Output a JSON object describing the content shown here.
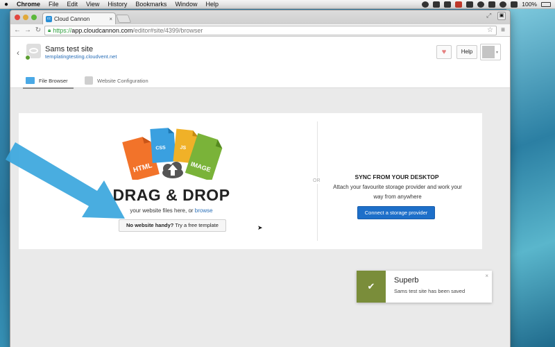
{
  "menubar": {
    "app": "Chrome",
    "items": [
      "File",
      "Edit",
      "View",
      "History",
      "Bookmarks",
      "Window",
      "Help"
    ],
    "battery": "100%"
  },
  "browser": {
    "tab_title": "Cloud Cannon",
    "tab_close": "×",
    "url": {
      "scheme": "https://",
      "host": "app.cloudcannon.com",
      "path": "/editor#site/4399/browser"
    }
  },
  "header": {
    "site_title": "Sams test site",
    "site_url": "templatingtesting.cloudvent.net",
    "help_label": "Help"
  },
  "tabs": [
    {
      "label": "File Browser"
    },
    {
      "label": "Website Configuration"
    }
  ],
  "upload": {
    "file_labels": [
      "HTML",
      "CSS",
      "JS",
      "IMAGE"
    ],
    "title": "DRAG & DROP",
    "subtitle_prefix": "your website files here, or",
    "browse_link": "browse",
    "template_bold": "No website handy?",
    "template_rest": "Try a free template",
    "or_label": "OR"
  },
  "sync": {
    "title": "SYNC FROM YOUR DESKTOP",
    "description": "Attach your favourite storage provider and work your way from anywhere",
    "connect_label": "Connect a storage provider",
    "providers": [
      "dropbox-icon",
      "google-drive-icon",
      "bitbucket-icon",
      "github-icon"
    ]
  },
  "toast": {
    "title": "Superb",
    "message": "Sams test site has been saved",
    "close": "×"
  },
  "colors": {
    "primary_button": "#1d6fc9",
    "link": "#2a6fb8",
    "toast_accent": "#7a8d3a",
    "arrow": "#3aa6dd",
    "html_file": "#f2732a",
    "css_file": "#3aa0e0",
    "js_file": "#f0b128",
    "image_file": "#7ab339"
  }
}
